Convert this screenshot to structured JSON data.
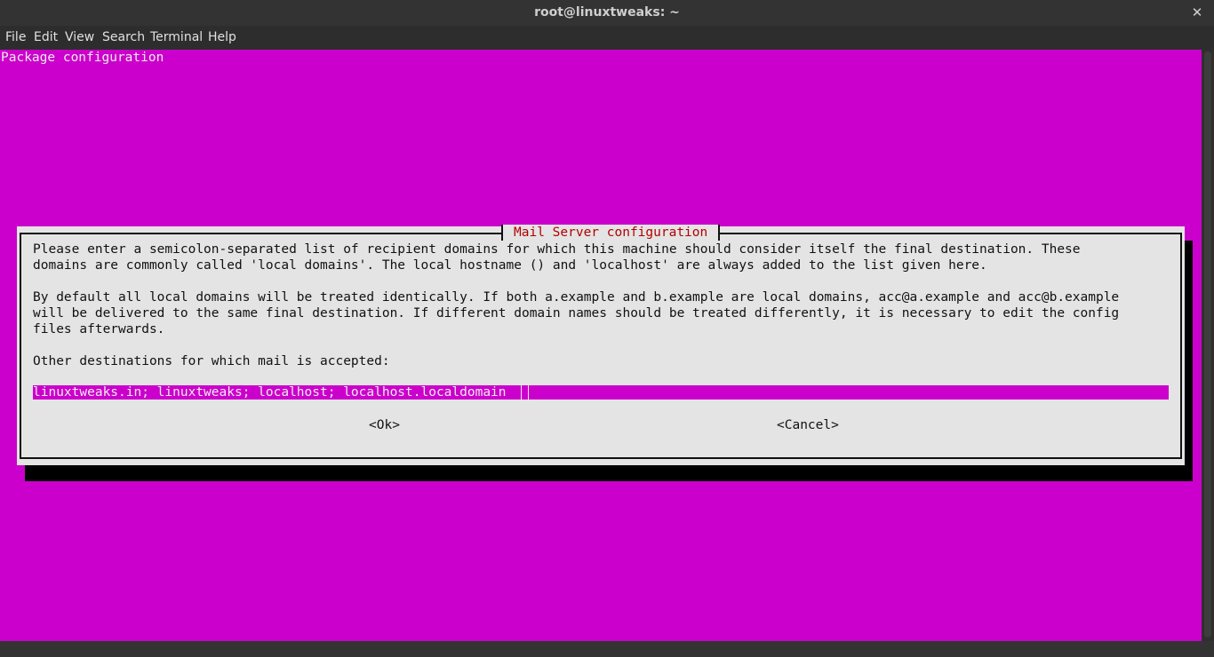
{
  "window": {
    "title": "root@linuxtweaks: ~",
    "close_glyph": "✕"
  },
  "menu": [
    "File",
    "Edit",
    "View",
    "Search",
    "Terminal",
    "Help"
  ],
  "terminal": {
    "header": "Package configuration",
    "background_color": "#cc00cc",
    "dialog": {
      "title": "Mail Server configuration",
      "paragraph1": [
        "Please enter a semicolon-separated list of recipient domains for which this machine should consider itself the final destination. These",
        "domains are commonly called 'local domains'. The local hostname () and 'localhost' are always added to the list given here."
      ],
      "paragraph2": [
        "By default all local domains will be treated identically. If both a.example and b.example are local domains, acc@a.example and acc@b.example",
        "will be delivered to the same final destination. If different domain names should be treated differently, it is necessary to edit the config",
        "files afterwards."
      ],
      "prompt": "Other destinations for which mail is accepted:",
      "input_value": "linuxtweaks.in; linuxtweaks; localhost; localhost.localdomain",
      "ok_label": "<Ok>",
      "cancel_label": "<Cancel>"
    }
  }
}
